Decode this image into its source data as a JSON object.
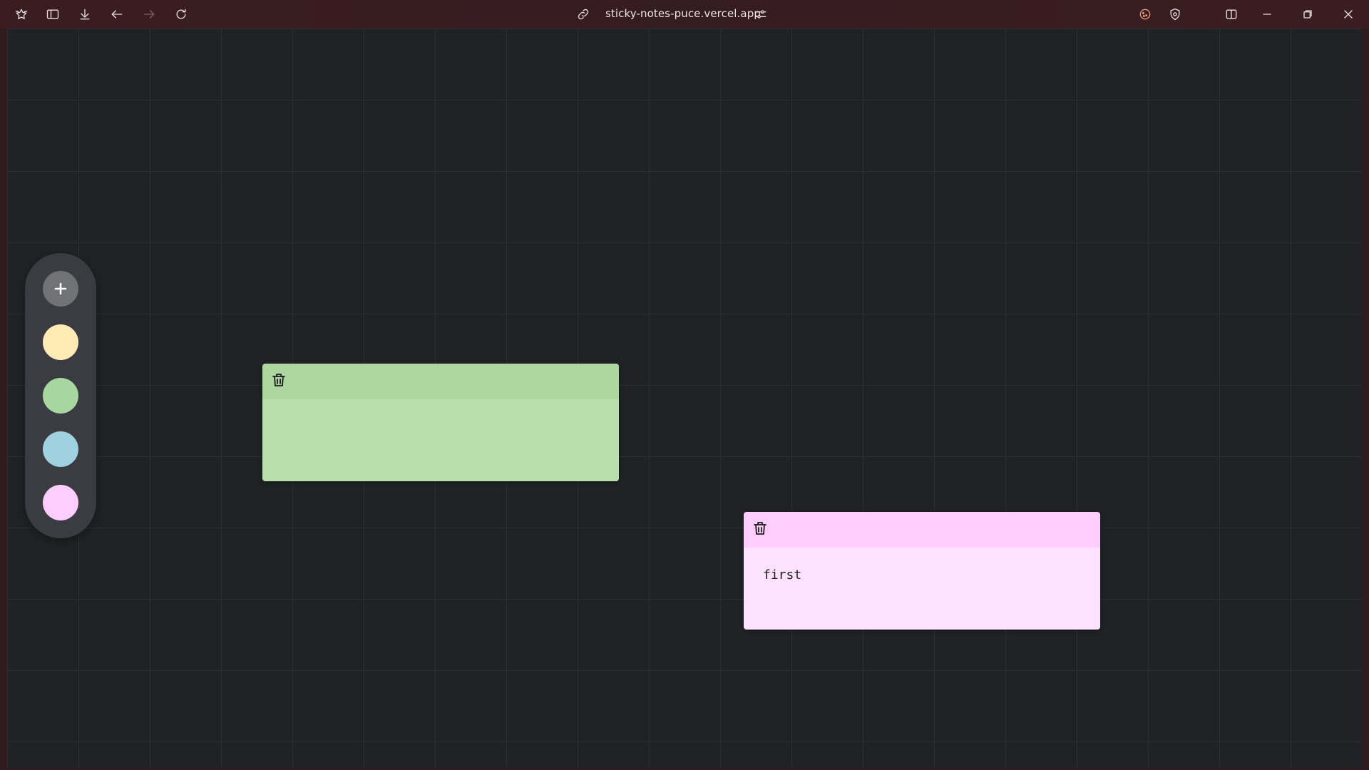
{
  "browser": {
    "url": "sticky-notes-puce.vercel.app",
    "icons": [
      "browser-logo-icon",
      "sidebar-toggle-icon",
      "download-icon",
      "back-icon",
      "forward-icon",
      "reload-icon",
      "link-icon",
      "site-settings-icon",
      "cookie-icon",
      "shield-icon",
      "split-view-icon",
      "minimize-icon",
      "restore-icon",
      "close-icon"
    ]
  },
  "palette": {
    "add_icon": "plus-icon",
    "colors": [
      "#ffebb3",
      "#a8d69f",
      "#9fd1e1",
      "#fdcdfd"
    ]
  },
  "notes": [
    {
      "header_color": "#acd89f",
      "body_color": "#bbdead",
      "text": ""
    },
    {
      "header_color": "#fecdfc",
      "body_color": "#fee1fc",
      "text": "first"
    }
  ]
}
